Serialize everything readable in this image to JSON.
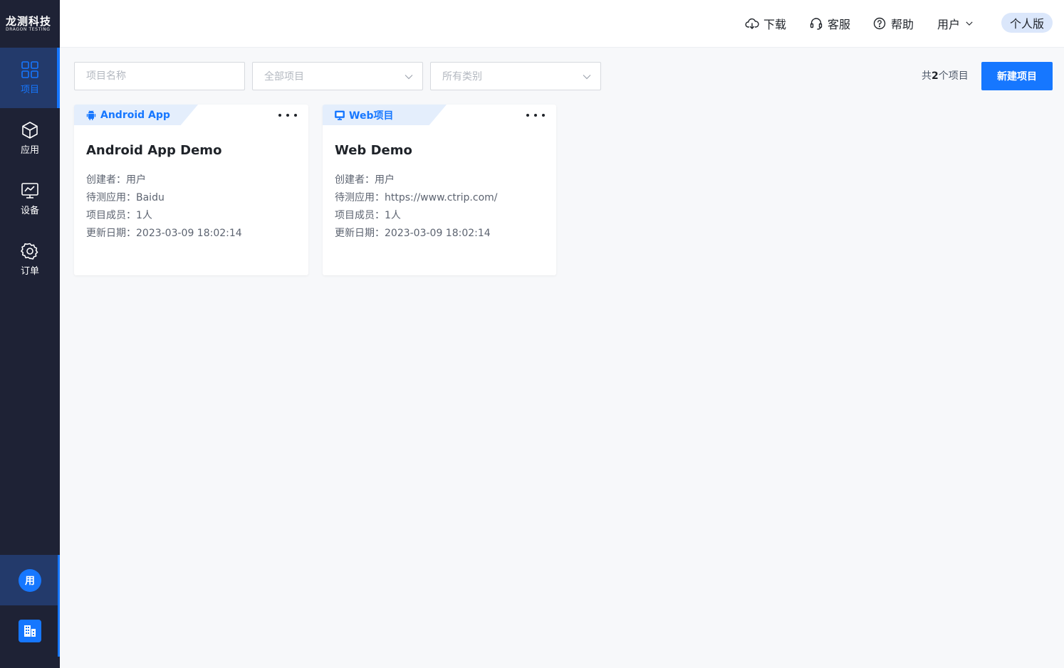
{
  "brand": {
    "name_cn": "龙测科技",
    "name_en": "DRAGON TESTING"
  },
  "sidebar": {
    "items": [
      {
        "label": "项目",
        "icon": "grid-icon",
        "active": true
      },
      {
        "label": "应用",
        "icon": "cube-icon"
      },
      {
        "label": "设备",
        "icon": "monitor-icon"
      },
      {
        "label": "订单",
        "icon": "gear-icon"
      }
    ],
    "avatar_text": "用",
    "org_icon": "building-icon"
  },
  "header": {
    "download": "下载",
    "support": "客服",
    "help": "帮助",
    "user": "用户",
    "edition": "个人版"
  },
  "filters": {
    "name_placeholder": "项目名称",
    "project_scope": "全部项目",
    "category": "所有类别"
  },
  "summary": {
    "prefix": "共",
    "count": "2",
    "suffix": "个项目"
  },
  "new_project_button": "新建项目",
  "projects": [
    {
      "tag": "Android App",
      "tag_icon": "android-icon",
      "title": "Android App Demo",
      "creator": "创建者：用户",
      "app": "待测应用：Baidu",
      "members": "项目成员：1人",
      "updated": "更新日期：2023-03-09 18:02:14"
    },
    {
      "tag": "Web项目",
      "tag_icon": "desktop-icon",
      "title": "Web Demo",
      "creator": "创建者：用户",
      "app": "待测应用：https://www.ctrip.com/",
      "members": "项目成员：1人",
      "updated": "更新日期：2023-03-09 18:02:14"
    }
  ],
  "colors": {
    "sidebar_bg": "#1e2235",
    "accent": "#1677ff",
    "active_bg": "#233a6b",
    "page_bg": "#f7f8fa",
    "tag_bg": "#e4eefc"
  }
}
